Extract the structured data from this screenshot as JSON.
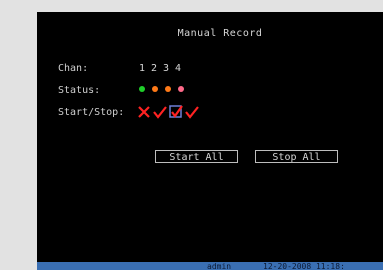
{
  "window": {
    "title": "Manual Record"
  },
  "rows": {
    "chan_label": "Chan:",
    "status_label": "Status:",
    "startstop_label": "Start/Stop:"
  },
  "channels": [
    "1",
    "2",
    "3",
    "4"
  ],
  "status_colors": [
    "#1fcf2a",
    "#ff7a18",
    "#ff7a18",
    "#ff6a8a"
  ],
  "start_stop_marks": [
    "cross",
    "check",
    "checkbox-checked",
    "check"
  ],
  "buttons": {
    "start_all": "Start All",
    "stop_all": "Stop All"
  },
  "statusbar": {
    "user": "admin",
    "datetime": "12-20-2008 11:18:"
  }
}
